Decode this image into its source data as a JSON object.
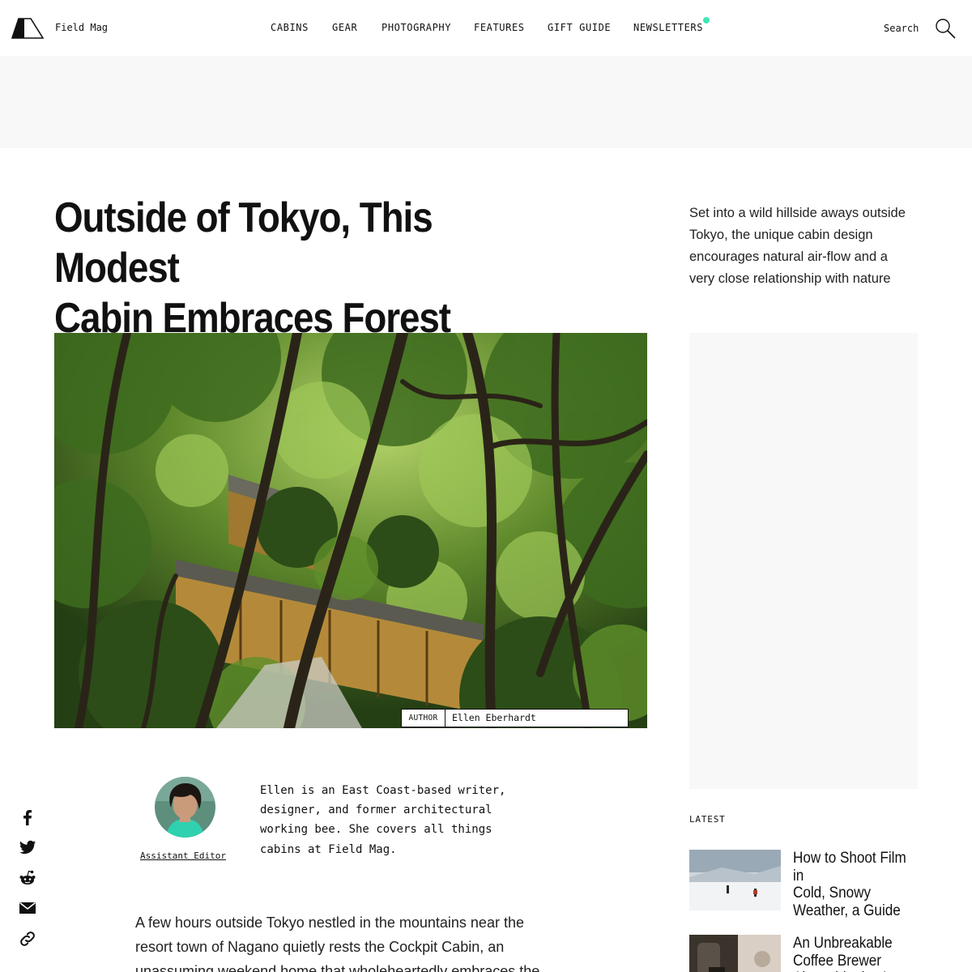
{
  "header": {
    "brand": "Field Mag",
    "nav": [
      "CABINS",
      "GEAR",
      "PHOTOGRAPHY",
      "FEATURES",
      "GIFT GUIDE",
      "NEWSLETTERS"
    ],
    "search_label": "Search",
    "accent_color": "#3fe6b8"
  },
  "article": {
    "title": "Outside of Tokyo, This Modest\nCabin Embraces Forest Bathing",
    "deck": "Set into a wild hillside aways outside\nTokyo, the unique cabin design\nencourages natural air-flow and a\nvery close relationship with nature",
    "photo_credit": {
      "label": "AUTHOR",
      "name": "Ellen Eberhardt"
    },
    "author": {
      "role": "Assistant Editor",
      "bio": "Ellen is an East Coast-based writer,\ndesigner, and former architectural\nworking bee. She covers all things\ncabins at Field Mag."
    },
    "body": "A few hours outside Tokyo nestled in the mountains near the\nresort town of Nagano quietly rests the Cockpit Cabin, an\nunassuming weekend home that wholeheartedly embraces the"
  },
  "share": {
    "icons": [
      "facebook-icon",
      "twitter-icon",
      "reddit-icon",
      "email-icon",
      "link-icon"
    ]
  },
  "sidebar": {
    "latest_label": "LATEST",
    "latest": [
      {
        "title": "How to Shoot Film in\nCold, Snowy\nWeather, a Guide"
      },
      {
        "title": "An Unbreakable\nCoffee Brewer\nAlongside the Art"
      }
    ]
  }
}
